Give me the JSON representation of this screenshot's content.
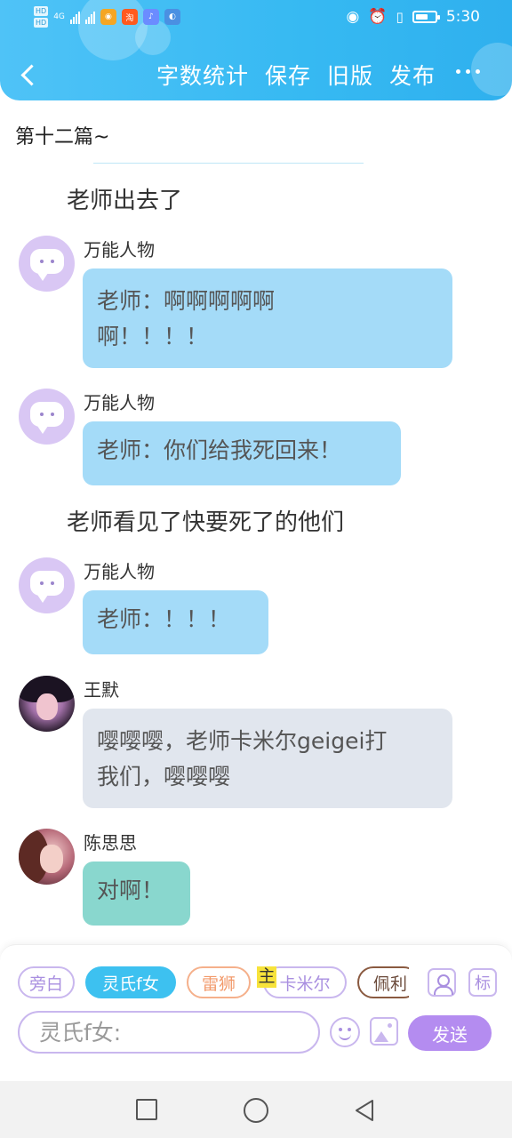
{
  "status_bar": {
    "time": "5:30",
    "badges": [
      "HD",
      "HD"
    ],
    "network": "4G"
  },
  "toolbar": {
    "items": [
      "字数统计",
      "保存",
      "旧版",
      "发布"
    ]
  },
  "chapter": {
    "title": "第十二篇~"
  },
  "narrations": [
    "老师出去了",
    "老师看见了快要死了的他们"
  ],
  "messages": [
    {
      "speaker": "万能人物",
      "lines": [
        "老师：啊啊啊啊啊",
        "啊！！！！"
      ],
      "bubble_color": "#a4dbf8"
    },
    {
      "speaker": "万能人物",
      "lines": [
        "老师：你们给我死回来！"
      ],
      "bubble_color": "#a4dbf8"
    },
    {
      "speaker": "万能人物",
      "lines": [
        "老师：！！！"
      ],
      "bubble_color": "#a4dbf8"
    },
    {
      "speaker": "王默",
      "lines": [
        "嘤嘤嘤，老师卡米尔geigei打",
        "我们，嘤嘤嘤"
      ],
      "bubble_color": "#e1e6ee"
    },
    {
      "speaker": "陈思思",
      "lines": [
        "对啊！"
      ],
      "bubble_color": "#89d7ce"
    }
  ],
  "characters": {
    "chips": [
      "旁白",
      "灵氏f女",
      "雷狮",
      "卡米尔",
      "佩利"
    ],
    "active": "灵氏f女",
    "marker": "主",
    "tag_button": "标"
  },
  "composer": {
    "placeholder": "灵氏f女:",
    "send_label": "发送"
  },
  "colors": {
    "header": "#36b9f2",
    "accent_purple": "#b48cf0",
    "active_chip": "#3dc1f0"
  }
}
